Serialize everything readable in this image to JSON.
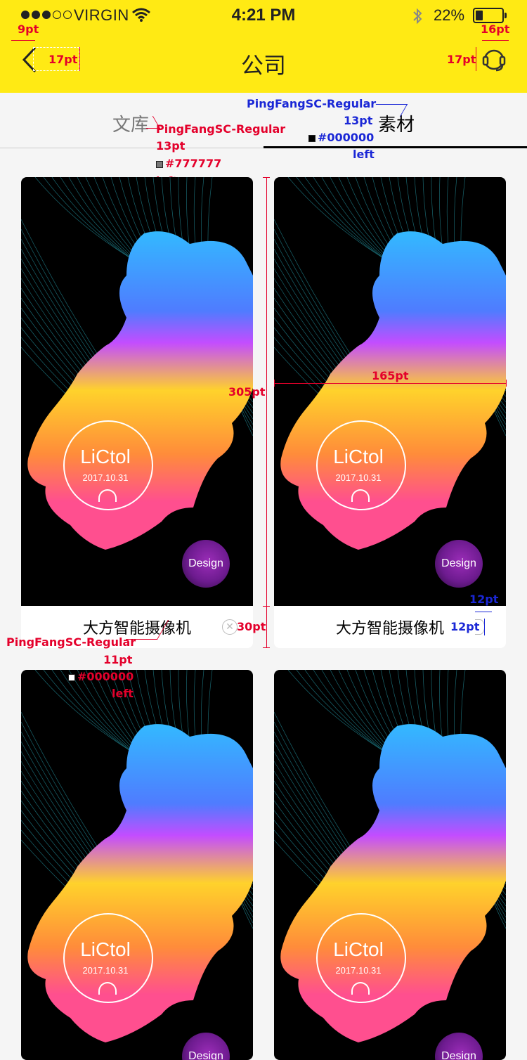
{
  "status_bar": {
    "carrier": "VIRGIN",
    "time": "4:21 PM",
    "battery": "22%"
  },
  "nav": {
    "title": "公司",
    "back_icon": "chevron-left-icon",
    "support_icon": "headset-icon"
  },
  "tabs": [
    {
      "label": "文库",
      "active": false
    },
    {
      "label": "素材",
      "active": true
    }
  ],
  "cards": [
    {
      "brand": "LiCtol",
      "date": "2017.10.31",
      "badge": "Design",
      "title": "大方智能摄像机"
    },
    {
      "brand": "LiCtol",
      "date": "2017.10.31",
      "badge": "Design",
      "title": "大方智能摄像机"
    },
    {
      "brand": "LiCtol",
      "date": "2017.10.31",
      "badge": "Design",
      "title": ""
    },
    {
      "brand": "LiCtol",
      "date": "2017.10.31",
      "badge": "Design",
      "title": ""
    }
  ],
  "annotations": {
    "back_margin": "9pt",
    "back_size": "17pt",
    "support_margin": "16pt",
    "support_size": "17pt",
    "tab_lib_spec": {
      "font": "PingFangSC-Regular",
      "size": "13pt",
      "color": "#777777",
      "align": "left"
    },
    "tab_mat_spec": {
      "font": "PingFangSC-Regular",
      "size": "13pt",
      "color": "#000000",
      "align": "left"
    },
    "card_height": "305pt",
    "card_width": "165pt",
    "footer_height": "30pt",
    "title_spec": {
      "font": "PingFangSC-Regular",
      "size": "11pt",
      "color": "#000000",
      "align": "left"
    },
    "delete_size": "12pt",
    "delete_margin": "12pt"
  }
}
